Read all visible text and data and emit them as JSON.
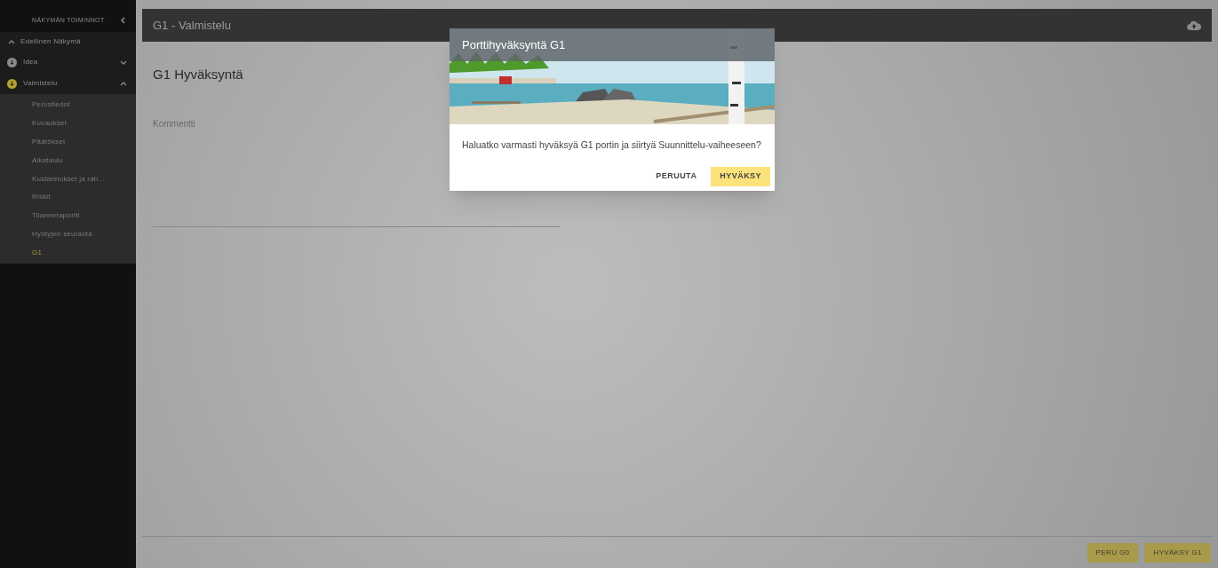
{
  "sidebar": {
    "title": "NÄKYMÄN TOIMINNOT",
    "back": "Edellinen Näkymä",
    "phases": [
      {
        "label": "Idea",
        "color": "#8a8a8a",
        "expanded": false
      },
      {
        "label": "Valmistelu",
        "color": "#b5a230",
        "expanded": true,
        "children": [
          {
            "label": "Perustiedot",
            "selected": false
          },
          {
            "label": "Kuvaukset",
            "selected": false
          },
          {
            "label": "Päätökset",
            "selected": false
          },
          {
            "label": "Aikataulu",
            "selected": false
          },
          {
            "label": "Kustannukset ja rah…",
            "selected": false
          },
          {
            "label": "Riskit",
            "selected": false
          },
          {
            "label": "Tilanneraportti",
            "selected": false
          },
          {
            "label": "Hyötyjen seuranta",
            "selected": false
          },
          {
            "label": "G1",
            "selected": true
          }
        ]
      }
    ]
  },
  "header": {
    "title": "G1 - Valmistelu"
  },
  "content": {
    "heading": "G1 Hyväksyntä",
    "comment_label": "Kommentti"
  },
  "footer_buttons": [
    "PERU G0",
    "HYVÄKSY G1"
  ],
  "dialog": {
    "title": "Porttihyväksyntä G1",
    "message": "Haluatko varmasti hyväksyä G1 portin ja siirtyä Suunnittelu-vaiheeseen?",
    "cancel": "PERUUTA",
    "confirm": "HYVÄKSY"
  }
}
